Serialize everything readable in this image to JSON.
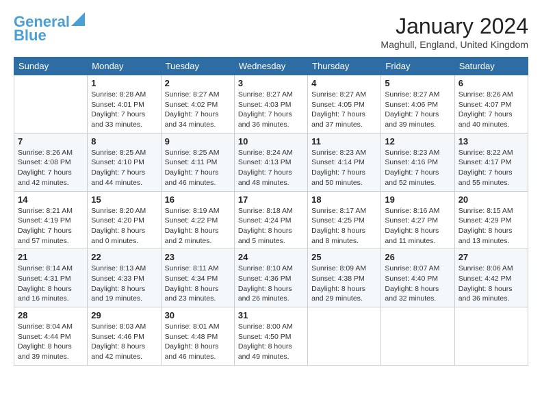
{
  "logo": {
    "line1": "General",
    "line2": "Blue"
  },
  "title": "January 2024",
  "location": "Maghull, England, United Kingdom",
  "days_of_week": [
    "Sunday",
    "Monday",
    "Tuesday",
    "Wednesday",
    "Thursday",
    "Friday",
    "Saturday"
  ],
  "weeks": [
    [
      {
        "day": "",
        "sunrise": "",
        "sunset": "",
        "daylight": ""
      },
      {
        "day": "1",
        "sunrise": "Sunrise: 8:28 AM",
        "sunset": "Sunset: 4:01 PM",
        "daylight": "Daylight: 7 hours and 33 minutes."
      },
      {
        "day": "2",
        "sunrise": "Sunrise: 8:27 AM",
        "sunset": "Sunset: 4:02 PM",
        "daylight": "Daylight: 7 hours and 34 minutes."
      },
      {
        "day": "3",
        "sunrise": "Sunrise: 8:27 AM",
        "sunset": "Sunset: 4:03 PM",
        "daylight": "Daylight: 7 hours and 36 minutes."
      },
      {
        "day": "4",
        "sunrise": "Sunrise: 8:27 AM",
        "sunset": "Sunset: 4:05 PM",
        "daylight": "Daylight: 7 hours and 37 minutes."
      },
      {
        "day": "5",
        "sunrise": "Sunrise: 8:27 AM",
        "sunset": "Sunset: 4:06 PM",
        "daylight": "Daylight: 7 hours and 39 minutes."
      },
      {
        "day": "6",
        "sunrise": "Sunrise: 8:26 AM",
        "sunset": "Sunset: 4:07 PM",
        "daylight": "Daylight: 7 hours and 40 minutes."
      }
    ],
    [
      {
        "day": "7",
        "sunrise": "Sunrise: 8:26 AM",
        "sunset": "Sunset: 4:08 PM",
        "daylight": "Daylight: 7 hours and 42 minutes."
      },
      {
        "day": "8",
        "sunrise": "Sunrise: 8:25 AM",
        "sunset": "Sunset: 4:10 PM",
        "daylight": "Daylight: 7 hours and 44 minutes."
      },
      {
        "day": "9",
        "sunrise": "Sunrise: 8:25 AM",
        "sunset": "Sunset: 4:11 PM",
        "daylight": "Daylight: 7 hours and 46 minutes."
      },
      {
        "day": "10",
        "sunrise": "Sunrise: 8:24 AM",
        "sunset": "Sunset: 4:13 PM",
        "daylight": "Daylight: 7 hours and 48 minutes."
      },
      {
        "day": "11",
        "sunrise": "Sunrise: 8:23 AM",
        "sunset": "Sunset: 4:14 PM",
        "daylight": "Daylight: 7 hours and 50 minutes."
      },
      {
        "day": "12",
        "sunrise": "Sunrise: 8:23 AM",
        "sunset": "Sunset: 4:16 PM",
        "daylight": "Daylight: 7 hours and 52 minutes."
      },
      {
        "day": "13",
        "sunrise": "Sunrise: 8:22 AM",
        "sunset": "Sunset: 4:17 PM",
        "daylight": "Daylight: 7 hours and 55 minutes."
      }
    ],
    [
      {
        "day": "14",
        "sunrise": "Sunrise: 8:21 AM",
        "sunset": "Sunset: 4:19 PM",
        "daylight": "Daylight: 7 hours and 57 minutes."
      },
      {
        "day": "15",
        "sunrise": "Sunrise: 8:20 AM",
        "sunset": "Sunset: 4:20 PM",
        "daylight": "Daylight: 8 hours and 0 minutes."
      },
      {
        "day": "16",
        "sunrise": "Sunrise: 8:19 AM",
        "sunset": "Sunset: 4:22 PM",
        "daylight": "Daylight: 8 hours and 2 minutes."
      },
      {
        "day": "17",
        "sunrise": "Sunrise: 8:18 AM",
        "sunset": "Sunset: 4:24 PM",
        "daylight": "Daylight: 8 hours and 5 minutes."
      },
      {
        "day": "18",
        "sunrise": "Sunrise: 8:17 AM",
        "sunset": "Sunset: 4:25 PM",
        "daylight": "Daylight: 8 hours and 8 minutes."
      },
      {
        "day": "19",
        "sunrise": "Sunrise: 8:16 AM",
        "sunset": "Sunset: 4:27 PM",
        "daylight": "Daylight: 8 hours and 11 minutes."
      },
      {
        "day": "20",
        "sunrise": "Sunrise: 8:15 AM",
        "sunset": "Sunset: 4:29 PM",
        "daylight": "Daylight: 8 hours and 13 minutes."
      }
    ],
    [
      {
        "day": "21",
        "sunrise": "Sunrise: 8:14 AM",
        "sunset": "Sunset: 4:31 PM",
        "daylight": "Daylight: 8 hours and 16 minutes."
      },
      {
        "day": "22",
        "sunrise": "Sunrise: 8:13 AM",
        "sunset": "Sunset: 4:33 PM",
        "daylight": "Daylight: 8 hours and 19 minutes."
      },
      {
        "day": "23",
        "sunrise": "Sunrise: 8:11 AM",
        "sunset": "Sunset: 4:34 PM",
        "daylight": "Daylight: 8 hours and 23 minutes."
      },
      {
        "day": "24",
        "sunrise": "Sunrise: 8:10 AM",
        "sunset": "Sunset: 4:36 PM",
        "daylight": "Daylight: 8 hours and 26 minutes."
      },
      {
        "day": "25",
        "sunrise": "Sunrise: 8:09 AM",
        "sunset": "Sunset: 4:38 PM",
        "daylight": "Daylight: 8 hours and 29 minutes."
      },
      {
        "day": "26",
        "sunrise": "Sunrise: 8:07 AM",
        "sunset": "Sunset: 4:40 PM",
        "daylight": "Daylight: 8 hours and 32 minutes."
      },
      {
        "day": "27",
        "sunrise": "Sunrise: 8:06 AM",
        "sunset": "Sunset: 4:42 PM",
        "daylight": "Daylight: 8 hours and 36 minutes."
      }
    ],
    [
      {
        "day": "28",
        "sunrise": "Sunrise: 8:04 AM",
        "sunset": "Sunset: 4:44 PM",
        "daylight": "Daylight: 8 hours and 39 minutes."
      },
      {
        "day": "29",
        "sunrise": "Sunrise: 8:03 AM",
        "sunset": "Sunset: 4:46 PM",
        "daylight": "Daylight: 8 hours and 42 minutes."
      },
      {
        "day": "30",
        "sunrise": "Sunrise: 8:01 AM",
        "sunset": "Sunset: 4:48 PM",
        "daylight": "Daylight: 8 hours and 46 minutes."
      },
      {
        "day": "31",
        "sunrise": "Sunrise: 8:00 AM",
        "sunset": "Sunset: 4:50 PM",
        "daylight": "Daylight: 8 hours and 49 minutes."
      },
      {
        "day": "",
        "sunrise": "",
        "sunset": "",
        "daylight": ""
      },
      {
        "day": "",
        "sunrise": "",
        "sunset": "",
        "daylight": ""
      },
      {
        "day": "",
        "sunrise": "",
        "sunset": "",
        "daylight": ""
      }
    ]
  ]
}
